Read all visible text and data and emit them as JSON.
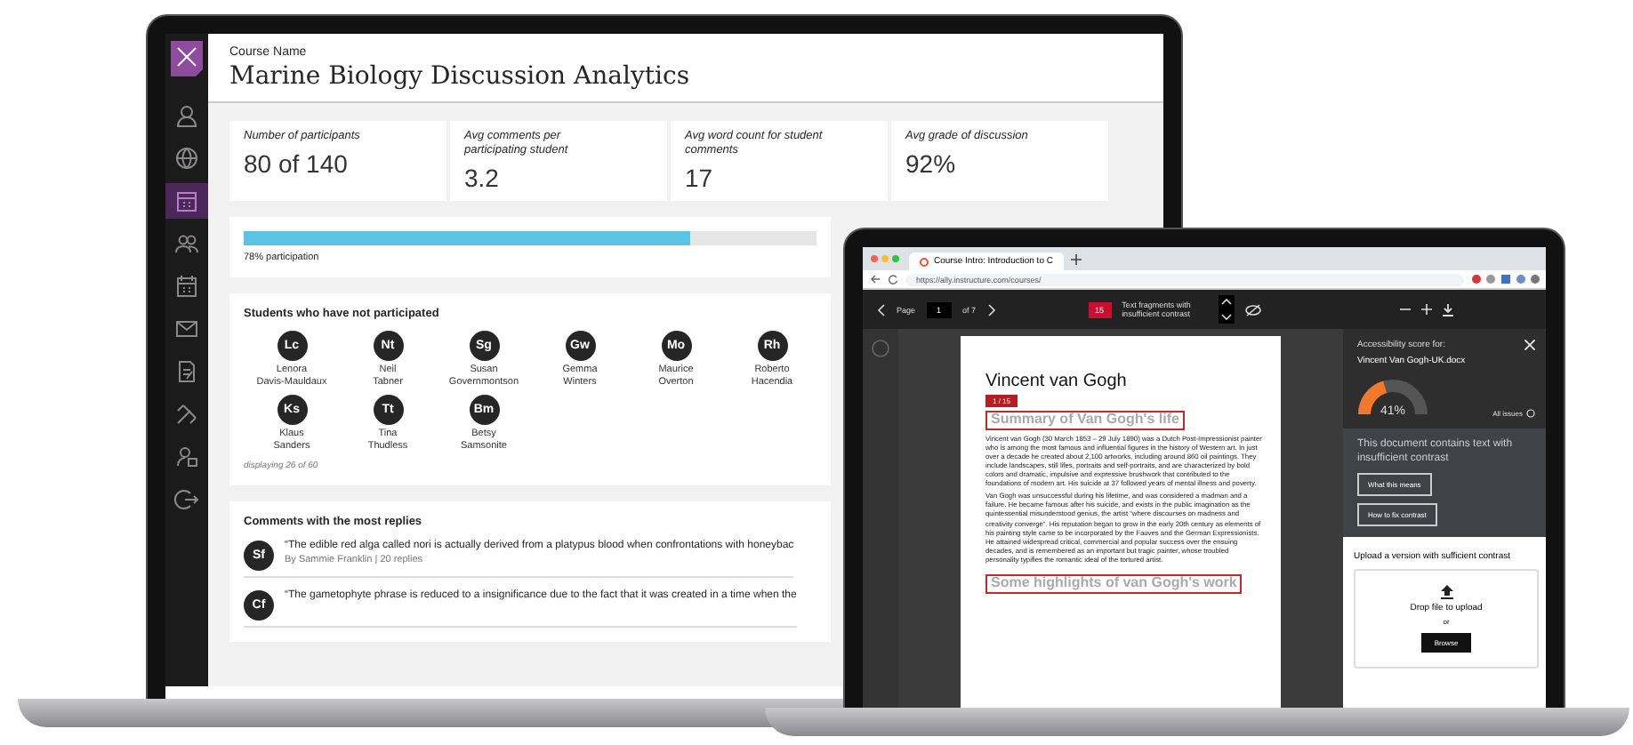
{
  "analytics": {
    "nav": [
      {
        "selected": false
      },
      {
        "selected": false
      },
      {
        "selected": true
      },
      {
        "selected": false
      },
      {
        "selected": false
      },
      {
        "selected": false
      },
      {
        "selected": false
      },
      {
        "selected": false
      },
      {
        "selected": false
      },
      {
        "selected": false
      }
    ],
    "course_label": "Course Name",
    "title": "Marine Biology Discussion Analytics",
    "stats": [
      {
        "label": "Number of participants",
        "value": "80 of 140"
      },
      {
        "label": "Avg comments per participating student",
        "value": "3.2"
      },
      {
        "label": "Avg word count for student comments",
        "value": "17"
      },
      {
        "label": "Avg grade of discussion",
        "value": "92%"
      }
    ],
    "participation": {
      "level": 0.78,
      "label": "78% participation"
    },
    "non_participants": {
      "heading": "Students who have not participated",
      "students": [
        {
          "initials": "Lc",
          "first": "Lenora",
          "last": "Davis-Mauldaux"
        },
        {
          "initials": "Nt",
          "first": "Neil",
          "last": "Tabner"
        },
        {
          "initials": "Sg",
          "first": "Susan",
          "last": "Governmontson"
        },
        {
          "initials": "Gw",
          "first": "Gemma",
          "last": "Winters"
        },
        {
          "initials": "Mo",
          "first": "Maurice",
          "last": "Overton"
        },
        {
          "initials": "Rh",
          "first": "Roberto",
          "last": "Hacendia"
        },
        {
          "initials": "Ks",
          "first": "Klaus",
          "last": "Sanders"
        },
        {
          "initials": "Tt",
          "first": "Tina",
          "last": "Thudless"
        },
        {
          "initials": "Bm",
          "first": "Betsy",
          "last": "Samsonite"
        }
      ],
      "footer": "displaying 26 of 60"
    },
    "top_comments": {
      "heading": "Comments with the most replies",
      "comments": [
        {
          "initials": "Sf",
          "text": "“The edible red alga called nori is actually derived from a platypus blood when confrontations with honeybac",
          "meta": "By Sammie Franklin | 20 replies"
        },
        {
          "initials": "Cf",
          "text": "“The gametophyte phrase is reduced to a insignificance due to the fact that it was created in a time when the"
        }
      ]
    }
  },
  "ally": {
    "tab_title": "Course Intro: Introduction to C",
    "url": "https://ally.instructure.com/courses/",
    "toolbar": {
      "page_label": "Page",
      "page": "1",
      "page_total": "of 7",
      "issue_count": "15",
      "issue_label": "Text fragments with insufficient contrast"
    },
    "document": {
      "title": "Vincent van Gogh",
      "flag": "1 / 15",
      "heading": "Summary of Van Gogh's life",
      "paragraphs": [
        "Vincent van Gogh (30 March 1853 – 29 July 1890) was a Dutch Post-Impressionist painter who is among the most famous and influential figures in the history of Western art. In just over a decade he created about 2,100 artworks, including around 860 oil paintings. They include landscapes, still lifes, portraits and self-portraits, and are characterized by bold colors and dramatic, impulsive and expressive brushwork that contributed to the foundations of modern art. His suicide at 37 followed years of mental illness and poverty.",
        "Van Gogh was unsuccessful during his lifetime, and was considered a madman and a failure. He became famous after his suicide, and exists in the public imagination as the quintessential misunderstood genius, the artist “where discourses on madness and creativity converge”. His reputation began to grow in the early 20th century as elements of his painting style came to be incorporated by the Fauves and the German Expressionists. He attained widespread critical, commercial and popular success over the ensuing decades, and is remembered as an important but tragic painter, whose troubled personality typifies the romantic ideal of the tortured artist."
      ],
      "heading2": "Some highlights of van Gogh's work"
    },
    "panel": {
      "score_label": "Accessibility score for:",
      "file": "Vincent Van Gogh-UK.docx",
      "score": {
        "level": 0.41,
        "text": "41%"
      },
      "all_issues": "All issues",
      "message": "This document contains text with insufficient contrast",
      "buttons": [
        "What this means",
        "How to fix contrast"
      ],
      "upload_label": "Upload a version with sufficient contrast",
      "drop_text": "Drop file to upload",
      "or": "or",
      "browse": "Browse"
    }
  }
}
